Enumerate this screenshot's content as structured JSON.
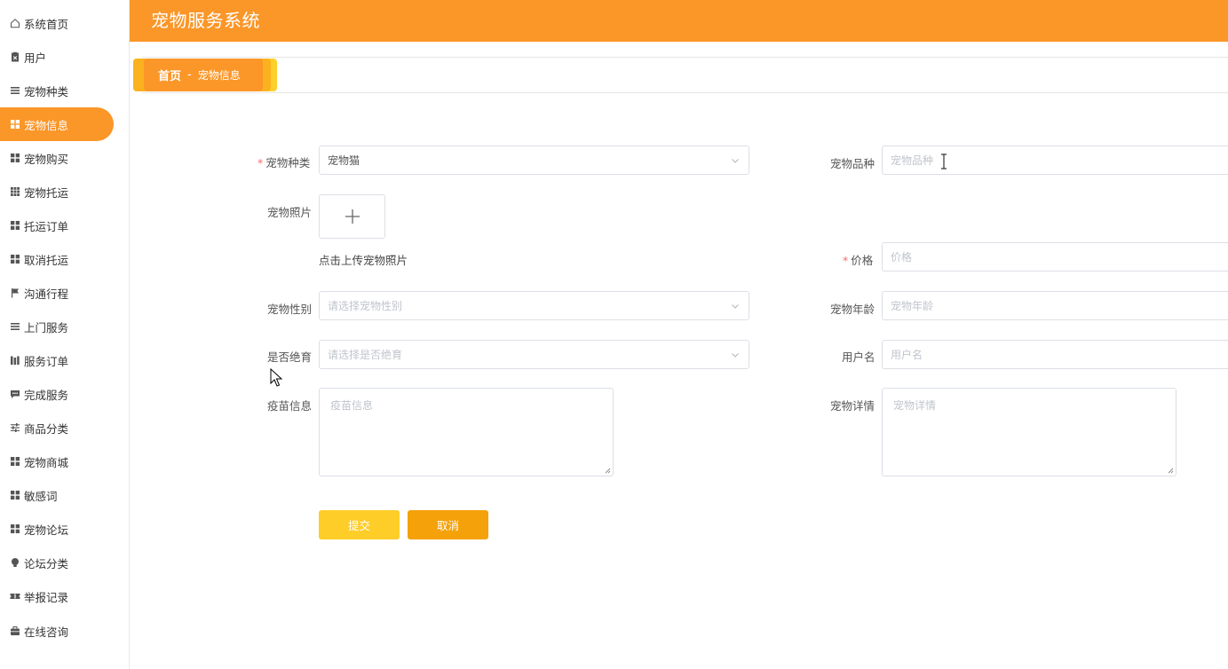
{
  "app": {
    "title": "宠物服务系统",
    "accent_color": "#fb9628"
  },
  "sidebar": {
    "items": [
      {
        "label": "系统首页",
        "icon": "home-icon"
      },
      {
        "label": "用户",
        "icon": "clipboard-icon"
      },
      {
        "label": "宠物种类",
        "icon": "list-icon"
      },
      {
        "label": "宠物信息",
        "icon": "grid-icon",
        "active": true
      },
      {
        "label": "宠物购买",
        "icon": "grid-icon"
      },
      {
        "label": "宠物托运",
        "icon": "grid-nine-icon"
      },
      {
        "label": "托运订单",
        "icon": "grid-icon"
      },
      {
        "label": "取消托运",
        "icon": "grid-icon"
      },
      {
        "label": "沟通行程",
        "icon": "flag-icon"
      },
      {
        "label": "上门服务",
        "icon": "list-icon"
      },
      {
        "label": "服务订单",
        "icon": "bars-icon"
      },
      {
        "label": "完成服务",
        "icon": "chat-icon"
      },
      {
        "label": "商品分类",
        "icon": "sliders-icon"
      },
      {
        "label": "宠物商城",
        "icon": "grid-icon"
      },
      {
        "label": "敏感词",
        "icon": "grid-icon"
      },
      {
        "label": "宠物论坛",
        "icon": "grid-icon"
      },
      {
        "label": "论坛分类",
        "icon": "lightbulb-icon"
      },
      {
        "label": "举报记录",
        "icon": "ticket-icon"
      },
      {
        "label": "在线咨询",
        "icon": "briefcase-icon"
      }
    ]
  },
  "breadcrumb": {
    "home": "首页",
    "separator": "-",
    "current": "宠物信息"
  },
  "form": {
    "pet_type": {
      "label": "宠物种类",
      "value": "宠物猫"
    },
    "pet_breed": {
      "label": "宠物品种",
      "placeholder": "宠物品种"
    },
    "pet_photo": {
      "label": "宠物照片",
      "hint": "点击上传宠物照片"
    },
    "price": {
      "label": "价格",
      "placeholder": "价格"
    },
    "pet_gender": {
      "label": "宠物性别",
      "placeholder": "请选择宠物性别"
    },
    "pet_age": {
      "label": "宠物年龄",
      "placeholder": "宠物年龄"
    },
    "neutered": {
      "label": "是否绝育",
      "placeholder": "请选择是否绝育"
    },
    "username": {
      "label": "用户名",
      "placeholder": "用户名"
    },
    "vaccine": {
      "label": "疫苗信息",
      "placeholder": "疫苗信息"
    },
    "pet_detail": {
      "label": "宠物详情",
      "placeholder": "宠物详情"
    },
    "required_mark": "*",
    "submit": "提交",
    "cancel": "取消"
  }
}
